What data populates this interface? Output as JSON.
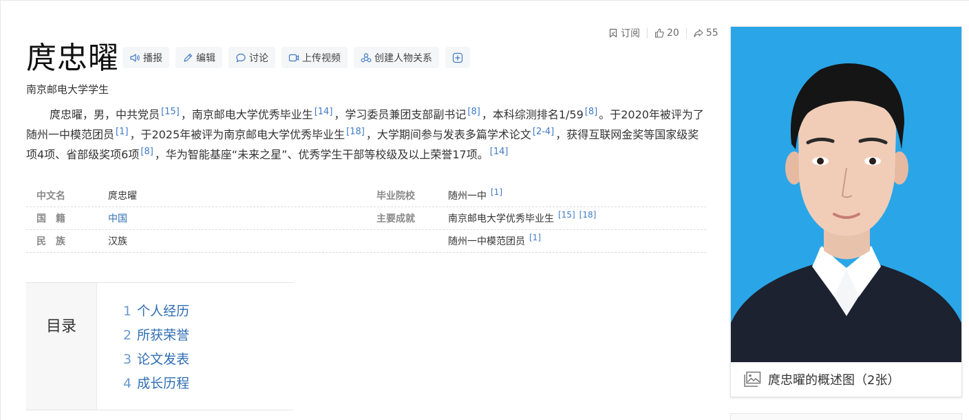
{
  "header": {
    "title": "庹忠曜",
    "subtitle": "南京邮电大学学生",
    "subscribe_label": "订阅",
    "like_count": "20",
    "share_count": "55"
  },
  "toolbar": {
    "broadcast": "播报",
    "edit": "编辑",
    "discuss": "讨论",
    "upload_video": "上传视频",
    "create_relation": "创建人物关系"
  },
  "summary": {
    "p1": "庹忠曜，男，中共党员",
    "r1": "[15]",
    "p2": "，南京邮电大学优秀毕业生",
    "r2": "[14]",
    "p3": "，学习委员兼团支部副书记",
    "r3": "[8]",
    "p4": "，本科综测排名1/59",
    "r4": "[8]",
    "p5": "。于2020年被评为了随州一中模范团员",
    "r5": "[1]",
    "p6": "，于2025年被评为南京邮电大学优秀毕业生",
    "r6": "[18]",
    "p7": "，大学期间参与发表多篇学术论文",
    "r7": "[2-4]",
    "p8": "，获得互联网金奖等国家级奖项4项、省部级奖项6项",
    "r8": "[8]",
    "p9": "，华为智能基座“未来之星”、优秀学生干部等校级及以上荣誉17项。",
    "r9": "[14]"
  },
  "info": {
    "name_key": "中文名",
    "name_val": "庹忠曜",
    "nation_key": "国　籍",
    "nation_val": "中国",
    "ethnic_key": "民　族",
    "ethnic_val": "汉族",
    "school_key": "毕业院校",
    "school_val": "随州一中",
    "school_ref": "[1]",
    "achieve_key": "主要成就",
    "achieve_val1": "南京邮电大学优秀毕业生",
    "achieve_ref1a": "[15]",
    "achieve_ref1b": "[18]",
    "achieve_val2": "随州一中模范团员",
    "achieve_ref2": "[1]"
  },
  "toc": {
    "heading": "目录",
    "items": [
      {
        "num": "1",
        "label": "个人经历"
      },
      {
        "num": "2",
        "label": "所获荣誉"
      },
      {
        "num": "3",
        "label": "论文发表"
      },
      {
        "num": "4",
        "label": "成长历程"
      }
    ]
  },
  "album": {
    "caption": "庹忠曜的概述图（2张）"
  },
  "colors": {
    "link": "#2e6db4",
    "photo_bg": "#28a6e8"
  }
}
